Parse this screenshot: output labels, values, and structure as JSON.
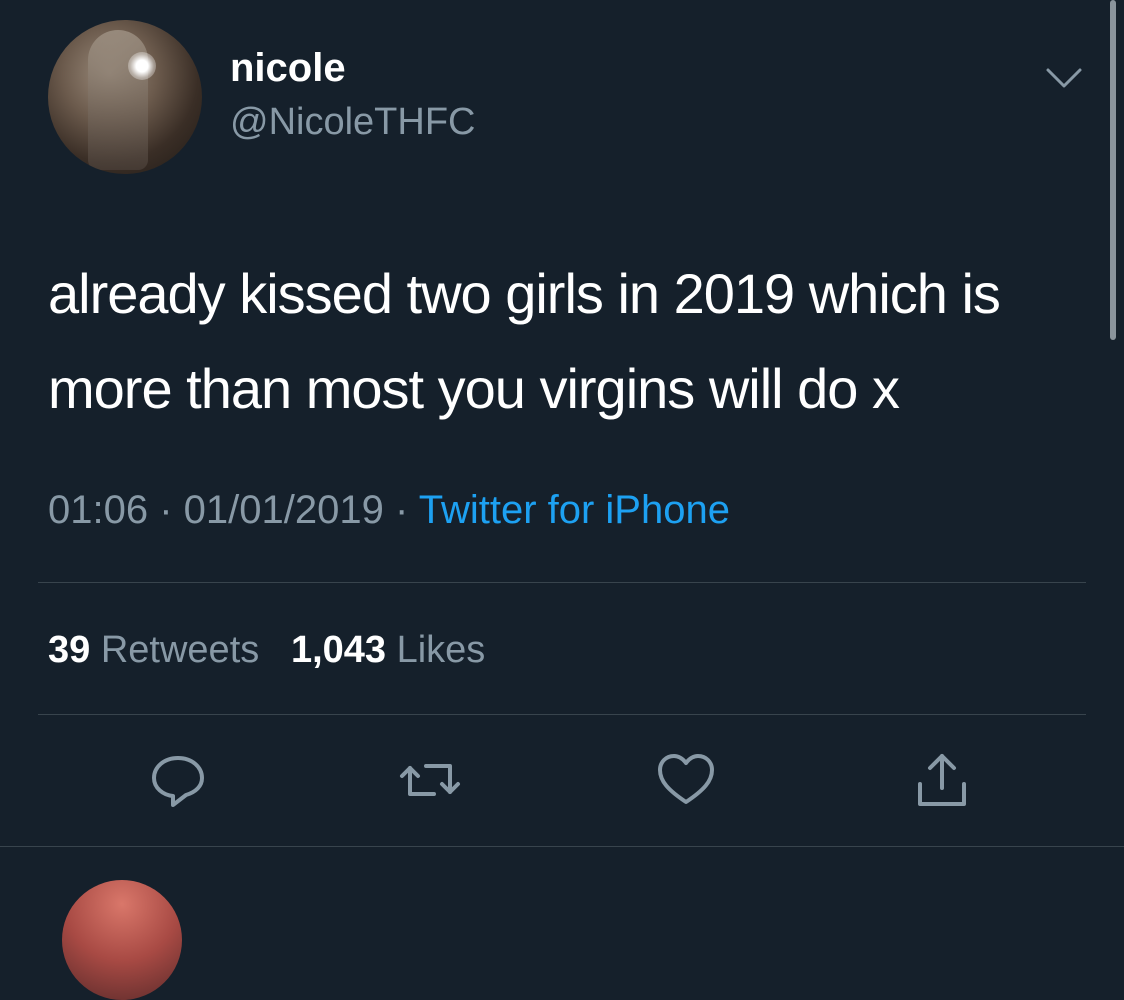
{
  "user": {
    "display_name": "nicole",
    "handle": "@NicoleTHFC"
  },
  "tweet": {
    "text": "already kissed two girls in 2019 which is more than most you virgins will do x",
    "time": "01:06",
    "date": "01/01/2019",
    "source": "Twitter for iPhone"
  },
  "stats": {
    "retweets_count": "39",
    "retweets_label": "Retweets",
    "likes_count": "1,043",
    "likes_label": "Likes"
  },
  "icons": {
    "caret": "chevron-down-icon",
    "reply": "reply-icon",
    "retweet": "retweet-icon",
    "like": "heart-icon",
    "share": "share-icon"
  },
  "colors": {
    "background": "#15202b",
    "secondary_text": "#8899a6",
    "link": "#1da1f2",
    "divider": "#38444d"
  }
}
